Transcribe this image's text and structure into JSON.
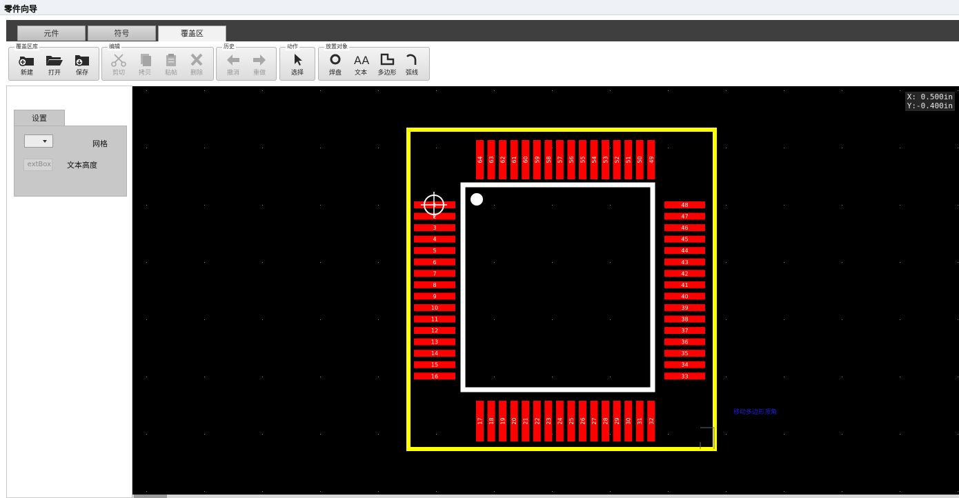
{
  "window": {
    "title": "零件向导"
  },
  "tabs": [
    {
      "label": "元件",
      "active": false
    },
    {
      "label": "符号",
      "active": false
    },
    {
      "label": "覆盖区",
      "active": true
    }
  ],
  "ribbon": {
    "library": {
      "label": "覆盖区库",
      "new": "新建",
      "open": "打开",
      "save": "保存"
    },
    "edit": {
      "label": "编辑",
      "cut": "剪切",
      "copy": "拷贝",
      "paste": "粘帖",
      "delete": "删除"
    },
    "history": {
      "label": "历史",
      "undo": "撤消",
      "redo": "重做"
    },
    "action": {
      "label": "动作",
      "select": "选择"
    },
    "place": {
      "label": "放置对象",
      "pad": "焊盘",
      "text": "文本",
      "polygon": "多边形",
      "arc": "弧线",
      "text_icon_glyph": "AA"
    }
  },
  "settings": {
    "tab_label": "设置",
    "grid_label": "网格",
    "grid_value": "",
    "text_height_label": "文本高度",
    "text_height_value": "extBox"
  },
  "canvas": {
    "coord_x": "X: 0.500in",
    "coord_y": "Y:-0.400in",
    "hint": "移动多边形顶角",
    "colors": {
      "background": "#000000",
      "outline": "#ffff00",
      "body": "#ffffff",
      "pad": "#ff0000"
    },
    "pins_top": [
      "64",
      "63",
      "62",
      "61",
      "60",
      "59",
      "58",
      "57",
      "56",
      "55",
      "54",
      "53",
      "52",
      "51",
      "50",
      "49"
    ],
    "pins_left": [
      "1",
      "2",
      "3",
      "4",
      "5",
      "6",
      "7",
      "8",
      "9",
      "10",
      "11",
      "12",
      "13",
      "14",
      "15",
      "16"
    ],
    "pins_right": [
      "48",
      "47",
      "46",
      "45",
      "44",
      "43",
      "42",
      "41",
      "40",
      "39",
      "38",
      "37",
      "36",
      "35",
      "34",
      "33"
    ],
    "pins_bottom": [
      "17",
      "18",
      "19",
      "20",
      "21",
      "22",
      "23",
      "24",
      "25",
      "26",
      "27",
      "28",
      "29",
      "30",
      "31",
      "32"
    ]
  }
}
